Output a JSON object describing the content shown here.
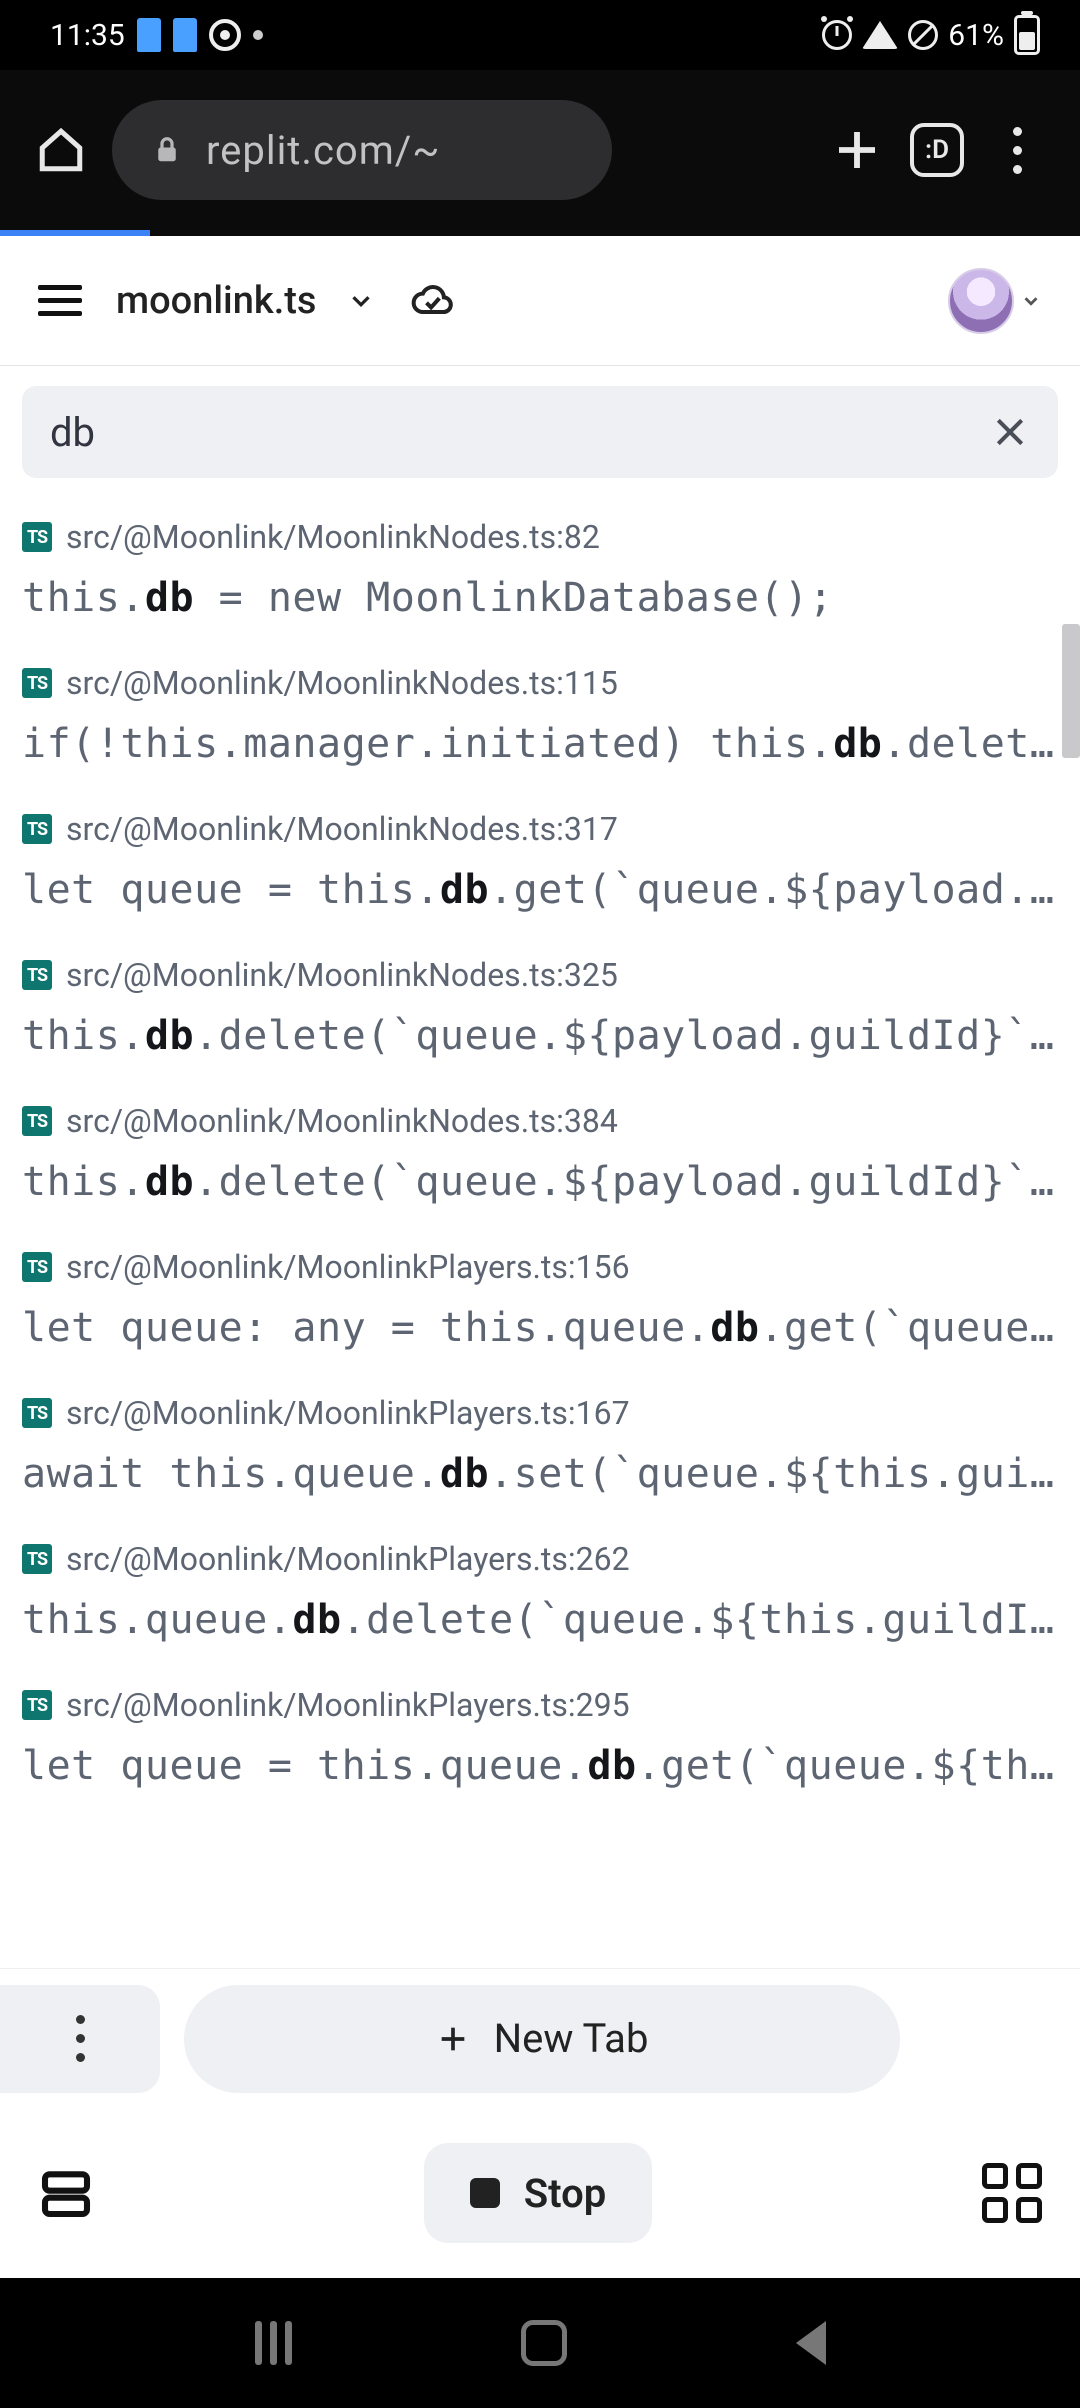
{
  "status": {
    "time": "11:35",
    "battery_pct": "61%"
  },
  "browser": {
    "url_display": "replit.com/~"
  },
  "file_header": {
    "filename": "moonlink.ts"
  },
  "search": {
    "query": "db"
  },
  "results": [
    {
      "path": "src/@Moonlink/MoonlinkNodes.ts:82",
      "code": {
        "pre": "this.",
        "match": "db",
        "post": " = new MoonlinkDatabase();"
      }
    },
    {
      "path": "src/@Moonlink/MoonlinkNodes.ts:115",
      "code": {
        "pre": "if(!this.manager.initiated) this.",
        "match": "db",
        "post": ".delet…"
      }
    },
    {
      "path": "src/@Moonlink/MoonlinkNodes.ts:317",
      "code": {
        "pre": "let queue = this.",
        "match": "db",
        "post": ".get(`queue.${payload.…"
      }
    },
    {
      "path": "src/@Moonlink/MoonlinkNodes.ts:325",
      "code": {
        "pre": "this.",
        "match": "db",
        "post": ".delete(`queue.${payload.guildId}`…"
      }
    },
    {
      "path": "src/@Moonlink/MoonlinkNodes.ts:384",
      "code": {
        "pre": "this.",
        "match": "db",
        "post": ".delete(`queue.${payload.guildId}`…"
      }
    },
    {
      "path": "src/@Moonlink/MoonlinkPlayers.ts:156",
      "code": {
        "pre": "let queue: any = this.queue.",
        "match": "db",
        "post": ".get(`queue…"
      }
    },
    {
      "path": "src/@Moonlink/MoonlinkPlayers.ts:167",
      "code": {
        "pre": "await this.queue.",
        "match": "db",
        "post": ".set(`queue.${this.gui…"
      }
    },
    {
      "path": "src/@Moonlink/MoonlinkPlayers.ts:262",
      "code": {
        "pre": "this.queue.",
        "match": "db",
        "post": ".delete(`queue.${this.guildI…"
      }
    },
    {
      "path": "src/@Moonlink/MoonlinkPlayers.ts:295",
      "code": {
        "pre": "let queue = this.queue.",
        "match": "db",
        "post": ".get(`queue.${th…"
      }
    }
  ],
  "bottom": {
    "new_tab_label": "New Tab",
    "stop_label": "Stop"
  }
}
